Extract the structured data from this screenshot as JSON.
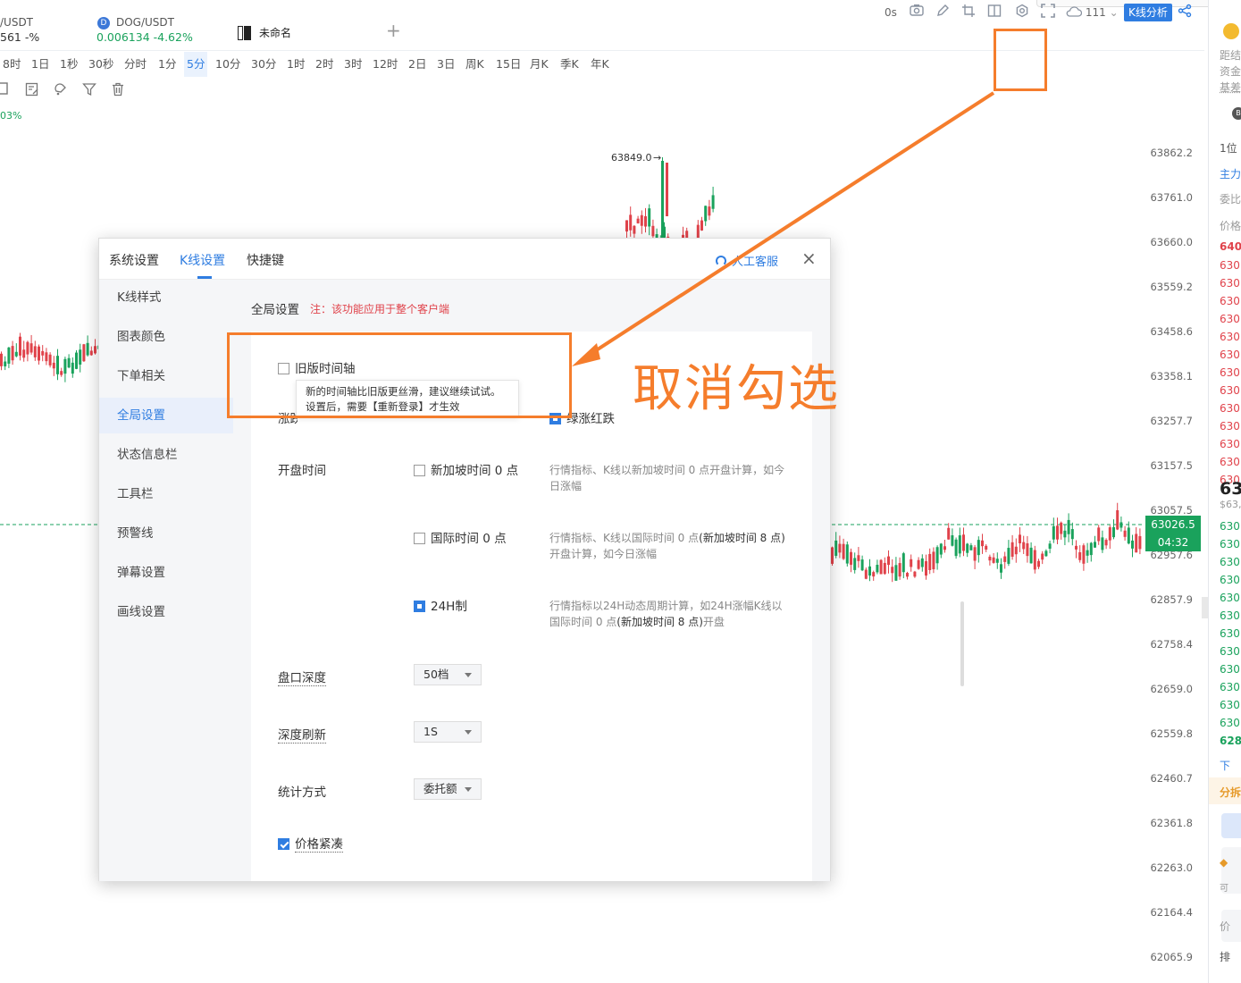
{
  "tabs": {
    "tab1": {
      "name": "/USDT",
      "quote": "561 -%"
    },
    "tab2": {
      "name": "DOG/USDT",
      "quote": "0.006134 -4.62%"
    },
    "tab3": {
      "name": "未命名"
    },
    "add": "+"
  },
  "timeframes": [
    "8时",
    "1日",
    "1秒",
    "30秒",
    "分时",
    "1分",
    "5分",
    "10分",
    "30分",
    "1时",
    "2时",
    "3时",
    "12时",
    "2日",
    "3日",
    "周K",
    "15日",
    "月K",
    "季K",
    "年K"
  ],
  "active_timeframe": "5分",
  "toolbar": {
    "countdown": "0s",
    "cloud_count": "111",
    "kline_btn": "K线分析"
  },
  "chart": {
    "percent_label": "03%",
    "peak_label": "63849.0",
    "price_ticks": [
      "63862.2",
      "63761.0",
      "63660.0",
      "63559.2",
      "63458.6",
      "63358.1",
      "63257.7",
      "63157.5",
      "63057.5",
      "62957.6",
      "62857.9",
      "62758.4",
      "62659.0",
      "62559.8",
      "62460.7",
      "62361.8",
      "62263.0",
      "62164.4",
      "62065.9"
    ],
    "last_price": "63026.5",
    "countdown": "04:32"
  },
  "modal": {
    "tabs": [
      "系统设置",
      "K线设置",
      "快捷键"
    ],
    "active_tab": "K线设置",
    "support": "人工客服",
    "close": "×",
    "menu": [
      "K线样式",
      "图表颜色",
      "下单相关",
      "全局设置",
      "状态信息栏",
      "工具栏",
      "预警线",
      "弹幕设置",
      "画线设置"
    ],
    "active_menu": "全局设置",
    "title": "全局设置",
    "note": "注：该功能应用于整个客户端",
    "legacy_axis": "旧版时间轴",
    "tooltip_line1": "新的时间轴比旧版更丝滑，建议继续试试。",
    "tooltip_line2": "设置后，需要【重新登录】才生效",
    "partial_label": "涨跌",
    "green_up": "绿涨红跌",
    "open_time_label": "开盘时间",
    "opt_sg": "新加坡时间 0 点",
    "desc_sg": "行情指标、K线以新加坡时间 0 点开盘计算，如今日涨幅",
    "opt_intl": "国际时间 0 点",
    "desc_intl_a": "行情指标、K线以国际时间 0 点",
    "desc_intl_b": "(新加坡时间 8 点)",
    "desc_intl_c": "开盘计算，如今日涨幅",
    "opt_24h": "24H制",
    "desc_24h_a": "行情指标以24H动态周期计算，如24H涨幅K线以国际时间 0 点",
    "desc_24h_b": "(新加坡时间 8 点)",
    "desc_24h_c": "开盘",
    "depth_label": "盘口深度",
    "depth_value": "50档",
    "refresh_label": "深度刷新",
    "refresh_value": "1S",
    "stat_label": "统计方式",
    "stat_value": "委托额",
    "compact_price": "价格紧凑"
  },
  "annotation": {
    "text": "取消勾选"
  },
  "rightpanel": {
    "t1": "距结",
    "t2": "资金",
    "t3": "基差",
    "t4": "1位",
    "t5": "主力",
    "t6": "委比",
    "t7": "价格",
    "t8": "640",
    "r": [
      "630",
      "630",
      "630",
      "630",
      "630",
      "630",
      "630",
      "630",
      "630",
      "630",
      "630",
      "630",
      "630"
    ],
    "big": "63",
    "sub": "$63,",
    "g": [
      "630",
      "630",
      "630",
      "630",
      "630",
      "630",
      "630",
      "630",
      "630",
      "630",
      "630",
      "630"
    ],
    "last": "628",
    "down": "下",
    "fen": "分拆",
    "ke": "可",
    "jia": "价",
    "pai": "排"
  },
  "colors": {
    "accent": "#2f7de1",
    "up": "#1aa25c",
    "down": "#e0424a",
    "annotation": "#f57d2c"
  }
}
